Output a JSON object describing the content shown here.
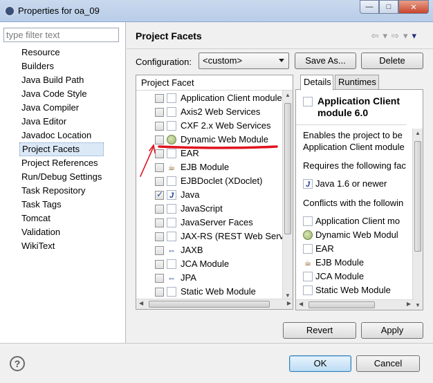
{
  "window": {
    "title": "Properties for oa_09",
    "min_symbol": "—",
    "max_symbol": "□",
    "close_symbol": "✕"
  },
  "sidebar": {
    "filter_placeholder": "type filter text",
    "items": [
      {
        "label": "Resource"
      },
      {
        "label": "Builders"
      },
      {
        "label": "Java Build Path"
      },
      {
        "label": "Java Code Style"
      },
      {
        "label": "Java Compiler"
      },
      {
        "label": "Java Editor"
      },
      {
        "label": "Javadoc Location"
      },
      {
        "label": "Project Facets",
        "selected": true
      },
      {
        "label": "Project References"
      },
      {
        "label": "Run/Debug Settings"
      },
      {
        "label": "Task Repository"
      },
      {
        "label": "Task Tags"
      },
      {
        "label": "Tomcat"
      },
      {
        "label": "Validation"
      },
      {
        "label": "WikiText"
      }
    ]
  },
  "main": {
    "page_title": "Project Facets",
    "back_arrow": "⇦",
    "forward_arrow": "⇨",
    "menu_arrow": "▾",
    "configuration_label": "Configuration:",
    "configuration_value": "<custom>",
    "save_as_label": "Save As...",
    "delete_label": "Delete",
    "facet_column_header": "Project Facet",
    "facets": [
      {
        "label": "Application Client module",
        "checked": false,
        "icon": "blank-file-icon"
      },
      {
        "label": "Axis2 Web Services",
        "checked": false,
        "icon": "blank-file-icon"
      },
      {
        "label": "CXF 2.x Web Services",
        "checked": false,
        "icon": "blank-file-icon"
      },
      {
        "label": "Dynamic Web Module",
        "checked": false,
        "icon": "globe-icon"
      },
      {
        "label": "EAR",
        "checked": false,
        "icon": "blank-file-icon"
      },
      {
        "label": "EJB Module",
        "checked": false,
        "icon": "bean-icon"
      },
      {
        "label": "EJBDoclet (XDoclet)",
        "checked": false,
        "icon": "blank-file-icon"
      },
      {
        "label": "Java",
        "checked": true,
        "icon": "java-icon"
      },
      {
        "label": "JavaScript",
        "checked": false,
        "icon": "blank-file-icon"
      },
      {
        "label": "JavaServer Faces",
        "checked": false,
        "icon": "blank-file-icon"
      },
      {
        "label": "JAX-RS (REST Web Servic",
        "checked": false,
        "icon": "blank-file-icon"
      },
      {
        "label": "JAXB",
        "checked": false,
        "icon": "double-arrow-icon"
      },
      {
        "label": "JCA Module",
        "checked": false,
        "icon": "blank-file-icon"
      },
      {
        "label": "JPA",
        "checked": false,
        "icon": "double-arrow-icon"
      },
      {
        "label": "Static Web Module",
        "checked": false,
        "icon": "blank-file-icon"
      }
    ],
    "tabs": [
      {
        "label": "Details",
        "active": true
      },
      {
        "label": "Runtimes",
        "active": false
      }
    ],
    "details": {
      "title": "Application Client module 6.0",
      "description_line1": "Enables the project to be",
      "description_line2": "Application Client module",
      "requires_label": "Requires the following fac",
      "requires": [
        {
          "label": "Java 1.6 or newer",
          "icon": "java-icon"
        }
      ],
      "conflicts_label": "Conflicts with the followin",
      "conflicts": [
        {
          "label": "Application Client mo",
          "icon": "blank-file-icon"
        },
        {
          "label": "Dynamic Web Modul",
          "icon": "globe-icon"
        },
        {
          "label": "EAR",
          "icon": "blank-file-icon"
        },
        {
          "label": "EJB Module",
          "icon": "bean-icon"
        },
        {
          "label": "JCA Module",
          "icon": "blank-file-icon"
        },
        {
          "label": "Static Web Module",
          "icon": "blank-file-icon"
        }
      ]
    },
    "revert_label": "Revert",
    "apply_label": "Apply"
  },
  "footer": {
    "help_symbol": "?",
    "ok_label": "OK",
    "cancel_label": "Cancel"
  },
  "annotation_color": "#e0141e"
}
